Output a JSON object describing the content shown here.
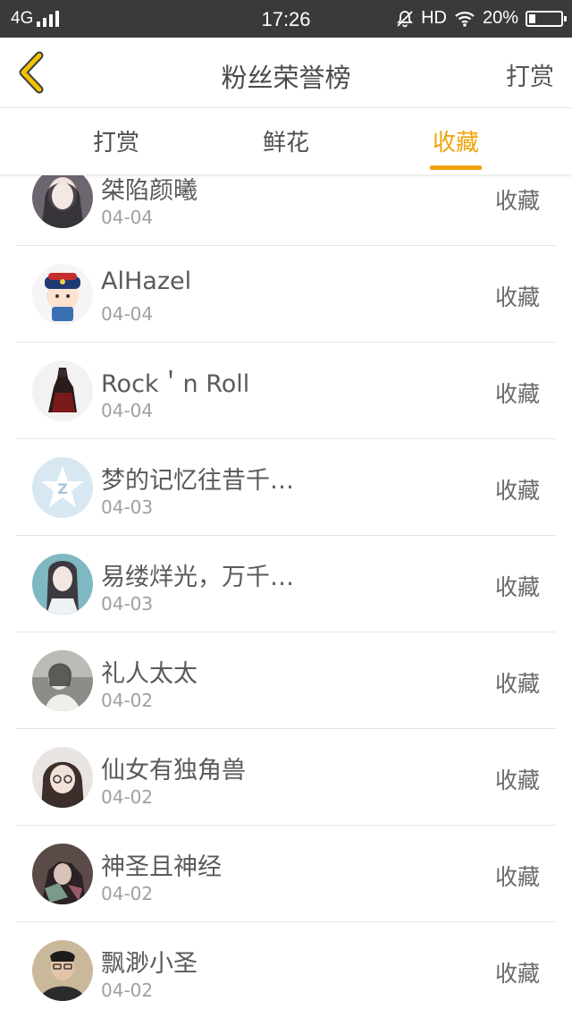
{
  "status_bar": {
    "network": "4G",
    "time": "17:26",
    "hd": "HD",
    "battery": "20%",
    "battery_level": 0.2
  },
  "header": {
    "title": "粉丝荣誉榜",
    "action": "打赏"
  },
  "tabs": [
    {
      "label": "打赏",
      "active": false
    },
    {
      "label": "鲜花",
      "active": false
    },
    {
      "label": "收藏",
      "active": true
    }
  ],
  "accent_color": "#f0a30a",
  "fans": [
    {
      "name": "桀陷颜曦",
      "date": "04-04",
      "action": "收藏"
    },
    {
      "name": "AlHazel",
      "date": "04-04",
      "action": "收藏"
    },
    {
      "name": "Rock＇n Roll",
      "date": "04-04",
      "action": "收藏"
    },
    {
      "name": "梦的记忆往昔千…",
      "date": "04-03",
      "action": "收藏"
    },
    {
      "name": "易缕烊光，万千…",
      "date": "04-03",
      "action": "收藏"
    },
    {
      "name": "礼人太太",
      "date": "04-02",
      "action": "收藏"
    },
    {
      "name": "仙女有独角兽",
      "date": "04-02",
      "action": "收藏"
    },
    {
      "name": "神圣且神经",
      "date": "04-02",
      "action": "收藏"
    },
    {
      "name": "飘渺小圣",
      "date": "04-02",
      "action": "收藏"
    }
  ]
}
